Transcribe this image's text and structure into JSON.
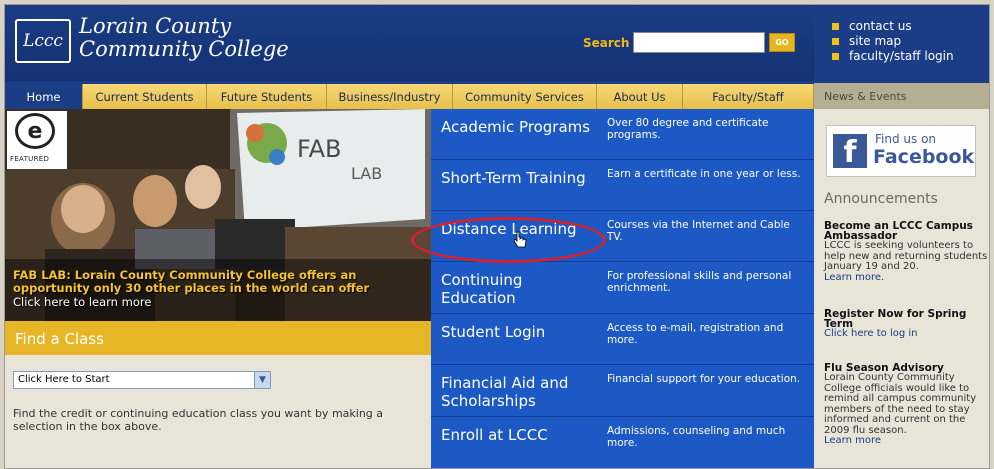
{
  "header": {
    "logo_text": "Lccc",
    "college_name_line1": "Lorain County",
    "college_name_line2": "Community College",
    "search_label": "Search",
    "search_value": "",
    "go_label": "GO",
    "util_links": [
      "contact us",
      "site map",
      "faculty/staff login"
    ]
  },
  "nav": {
    "tabs": [
      "Home",
      "Current Students",
      "Future Students",
      "Business/Industry",
      "Community Services",
      "About Us",
      "Faculty/Staff"
    ],
    "news_events": "News & Events"
  },
  "feature": {
    "badge_text": "FEATURED",
    "caption": "FAB LAB: Lorain County Community College offers an opportunity only 30 other places in the world can offer",
    "caption_link": "Click here to learn more",
    "screen_text": "FAB LAB"
  },
  "find_class": {
    "title": "Find a Class",
    "select_value": "Click Here to Start",
    "description": "Find the credit or continuing education class you want by making a selection in the box above."
  },
  "programs": [
    {
      "title": "Academic Programs",
      "desc": "Over 80 degree and certificate programs."
    },
    {
      "title": "Short-Term Training",
      "desc": "Earn a certificate in one year or less."
    },
    {
      "title": "Distance Learning",
      "desc": "Courses via the Internet and Cable TV."
    },
    {
      "title": "Continuing Education",
      "desc": "For professional skills and personal enrichment."
    },
    {
      "title": "Student Login",
      "desc": "Access to e-mail, registration and more."
    },
    {
      "title": "Financial Aid and Scholarships",
      "desc": "Financial support for your education."
    },
    {
      "title": "Enroll at LCCC",
      "desc": "Admissions, counseling and much more."
    }
  ],
  "sidebar": {
    "fb_find": "Find us on",
    "fb_name": "Facebook",
    "announcements_title": "Announcements",
    "announcements": [
      {
        "head": "Become an LCCC Campus Ambassador",
        "body": "LCCC is seeking volunteers to help new and returning students January 19 and 20.",
        "link": "Learn more."
      },
      {
        "head": "Register Now for Spring Term",
        "body": "",
        "link": "Click here to log in"
      },
      {
        "head": "Flu Season Advisory",
        "body": "Lorain County Community College officials would like to remind all campus community members of the need to stay informed and current on the 2009 flu season.",
        "link": "Learn more"
      }
    ]
  },
  "colors": {
    "brand_blue": "#1a3d85",
    "menu_blue": "#1d59c5",
    "gold": "#e7b626",
    "highlight_red": "#d42030"
  }
}
